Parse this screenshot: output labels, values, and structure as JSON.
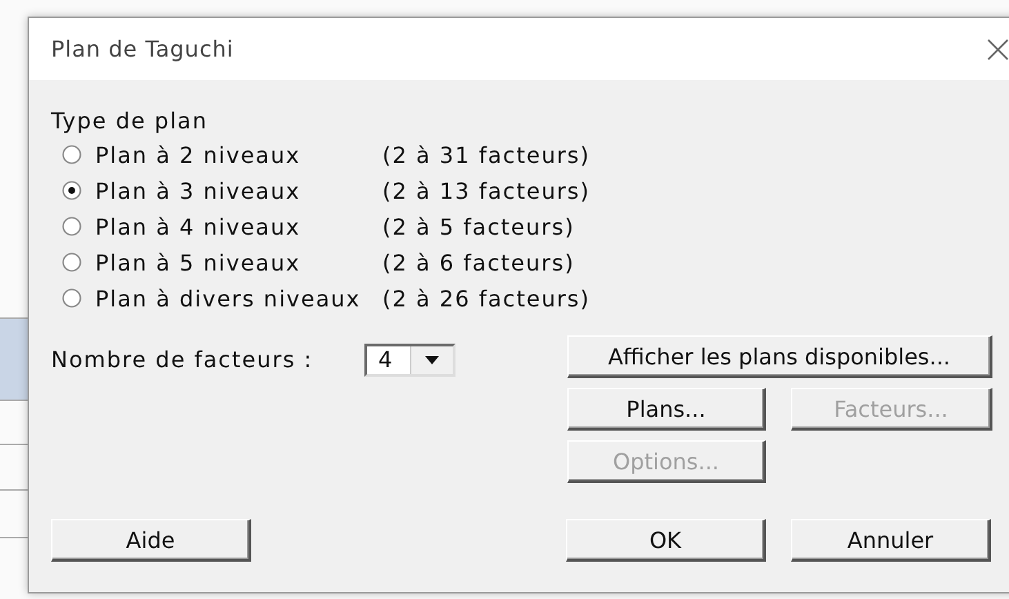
{
  "window": {
    "title": "Plan de Taguchi"
  },
  "plan_type": {
    "label": "Type de plan",
    "options": [
      {
        "label": "Plan à 2 niveaux",
        "range": "(2 à 31 facteurs)",
        "selected": false
      },
      {
        "label": "Plan à 3 niveaux",
        "range": "(2 à 13 facteurs)",
        "selected": true
      },
      {
        "label": "Plan à 4 niveaux",
        "range": "(2 à 5 facteurs)",
        "selected": false
      },
      {
        "label": "Plan à 5 niveaux",
        "range": "(2 à 6 facteurs)",
        "selected": false
      },
      {
        "label": "Plan à divers niveaux",
        "range": "(2 à 26 facteurs)",
        "selected": false
      }
    ]
  },
  "factor_count": {
    "label": "Nombre de facteurs :",
    "value": "4"
  },
  "buttons": [
    {
      "label": "Afficher les plans disponibles...",
      "disabled": false
    },
    {
      "label": "Plans...",
      "disabled": false
    },
    {
      "label": "Facteurs...",
      "disabled": true
    },
    {
      "label": "Options...",
      "disabled": true
    }
  ],
  "footer_buttons": [
    {
      "label": "Aide",
      "disabled": false
    },
    {
      "label": "OK",
      "disabled": false
    },
    {
      "label": "Annuler",
      "disabled": false
    }
  ]
}
